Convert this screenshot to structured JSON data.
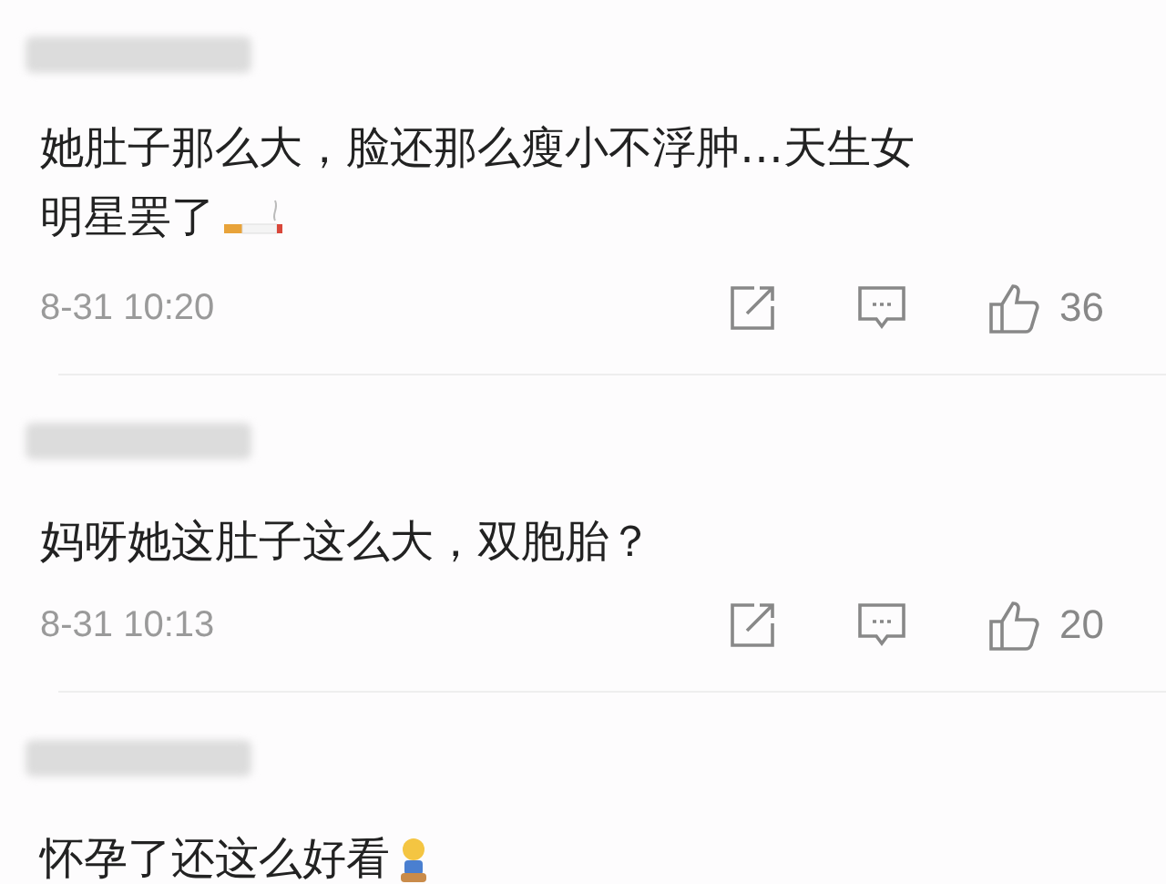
{
  "comments": [
    {
      "text": "她肚子那么大，脸还那么瘦小不浮肿…天生女明星罢了",
      "emoji": {
        "kind": "cigarette"
      },
      "time": "8-31 10:20",
      "likes": "36"
    },
    {
      "text": "妈呀她这肚子这么大，双胞胎？",
      "time": "8-31 10:13",
      "likes": "20"
    },
    {
      "text": "怀孕了还这么好看",
      "emoji": {
        "kind": "figure"
      }
    }
  ]
}
